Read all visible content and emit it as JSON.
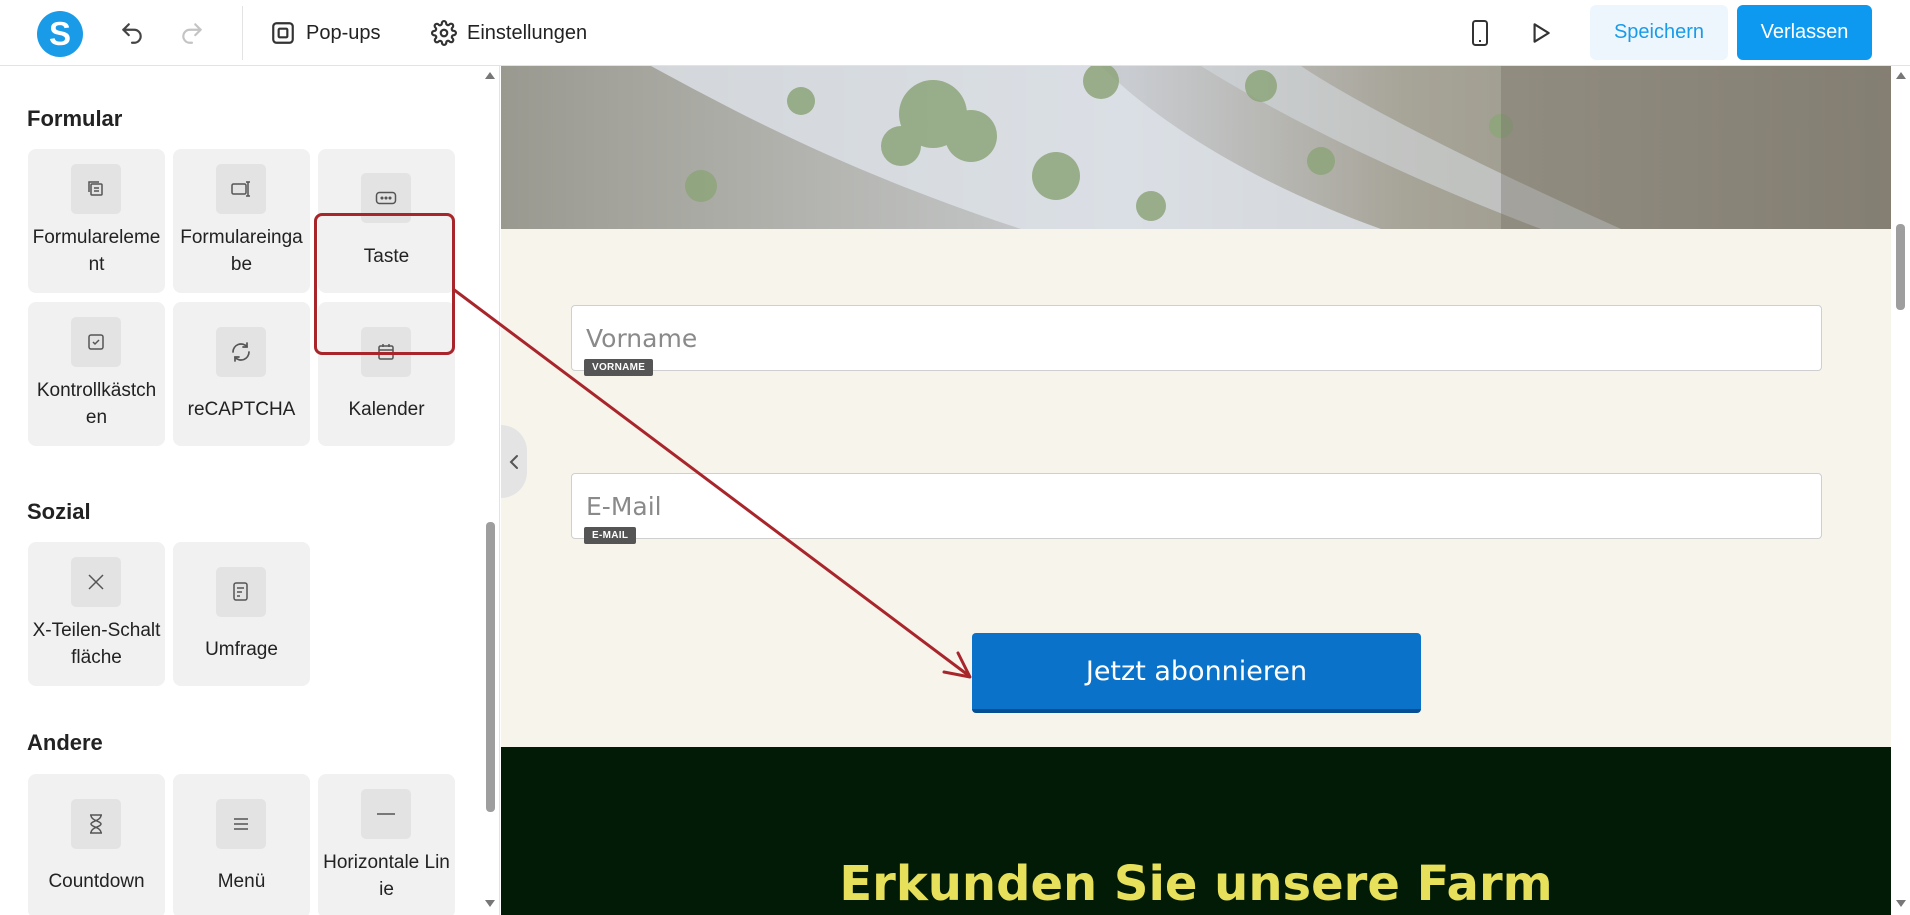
{
  "toolbar": {
    "logo_letter": "S",
    "popups_label": "Pop-ups",
    "settings_label": "Einstellungen",
    "save_label": "Speichern",
    "leave_label": "Verlassen"
  },
  "sections": {
    "form": {
      "title": "Formular",
      "items": [
        {
          "label": "Formularelement",
          "icon": "form-element-icon"
        },
        {
          "label": "Formulareingabe",
          "icon": "form-input-icon"
        },
        {
          "label": "Taste",
          "icon": "button-icon"
        },
        {
          "label": "Kontrollkästchen",
          "icon": "checkbox-icon"
        },
        {
          "label": "reCAPTCHA",
          "icon": "recaptcha-icon"
        },
        {
          "label": "Kalender",
          "icon": "calendar-icon"
        }
      ]
    },
    "social": {
      "title": "Sozial",
      "items": [
        {
          "label": "X-Teilen-Schaltfläche",
          "icon": "x-share-icon"
        },
        {
          "label": "Umfrage",
          "icon": "survey-icon"
        }
      ]
    },
    "other": {
      "title": "Andere",
      "items": [
        {
          "label": "Countdown",
          "icon": "hourglass-icon"
        },
        {
          "label": "Menü",
          "icon": "menu-icon"
        },
        {
          "label": "Horizontale Linie",
          "icon": "horizontal-line-icon"
        }
      ]
    }
  },
  "canvas": {
    "firstname": {
      "placeholder": "Vorname",
      "tag": "VORNAME"
    },
    "email": {
      "placeholder": "E-Mail",
      "tag": "E-MAIL"
    },
    "subscribe_label": "Jetzt abonnieren",
    "farm_heading": "Erkunden Sie unsere Farm"
  },
  "colors": {
    "accent": "#0d99f0",
    "subscribe_button": "#0a72c8",
    "highlight": "#a8262b",
    "dark_section": "#021b06",
    "heading": "#e7e05a"
  }
}
